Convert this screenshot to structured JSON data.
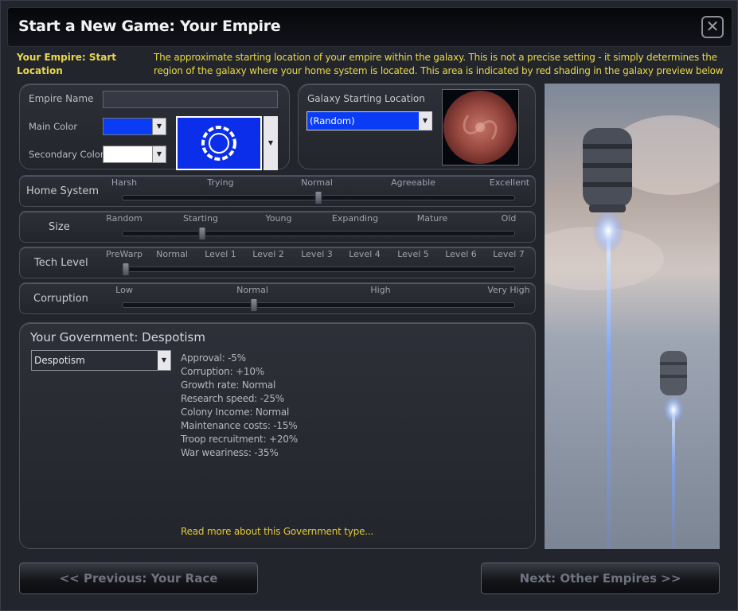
{
  "window": {
    "title": "Start a New Game: Your Empire",
    "close_icon": "close-icon"
  },
  "help": {
    "label": "Your Empire: Start Location",
    "text": "The approximate starting location of your empire within the galaxy. This is not a precise setting - it simply determines the region of the galaxy where your home system is located. This area is indicated by red shading in the galaxy preview below"
  },
  "empire": {
    "name_label": "Empire Name",
    "name_value": "",
    "main_color_label": "Main Color",
    "main_color": "#0a3cf5",
    "secondary_color_label": "Secondary Color",
    "secondary_color": "#ffffff",
    "flag_color": "#0b2eea"
  },
  "galaxy": {
    "label": "Galaxy Starting Location",
    "selected": "(Random)"
  },
  "sliders": [
    {
      "label": "Home System",
      "ticks": [
        "Harsh",
        "Trying",
        "Normal",
        "Agreeable",
        "Excellent"
      ],
      "value_index": 2
    },
    {
      "label": "Size",
      "ticks": [
        "Random",
        "Starting",
        "Young",
        "Expanding",
        "Mature",
        "Old"
      ],
      "value_index": 1
    },
    {
      "label": "Tech Level",
      "ticks": [
        "PreWarp",
        "Normal",
        "Level 1",
        "Level 2",
        "Level 3",
        "Level 4",
        "Level 5",
        "Level 6",
        "Level 7"
      ],
      "value_index": 0
    },
    {
      "label": "Corruption",
      "ticks": [
        "Low",
        "Normal",
        "High",
        "Very High"
      ],
      "value_index": 1
    }
  ],
  "government": {
    "title": "Your Government: Despotism",
    "selected": "Despotism",
    "stats": [
      "Approval: -5%",
      "Corruption: +10%",
      "Growth rate: Normal",
      "Research speed: -25%",
      "Colony Income: Normal",
      "Maintenance costs: -15%",
      "Troop recruitment: +20%",
      "War weariness: -35%"
    ],
    "read_more": "Read more about this Government type..."
  },
  "nav": {
    "previous": "<< Previous: Your Race",
    "next": "Next: Other Empires >>"
  }
}
